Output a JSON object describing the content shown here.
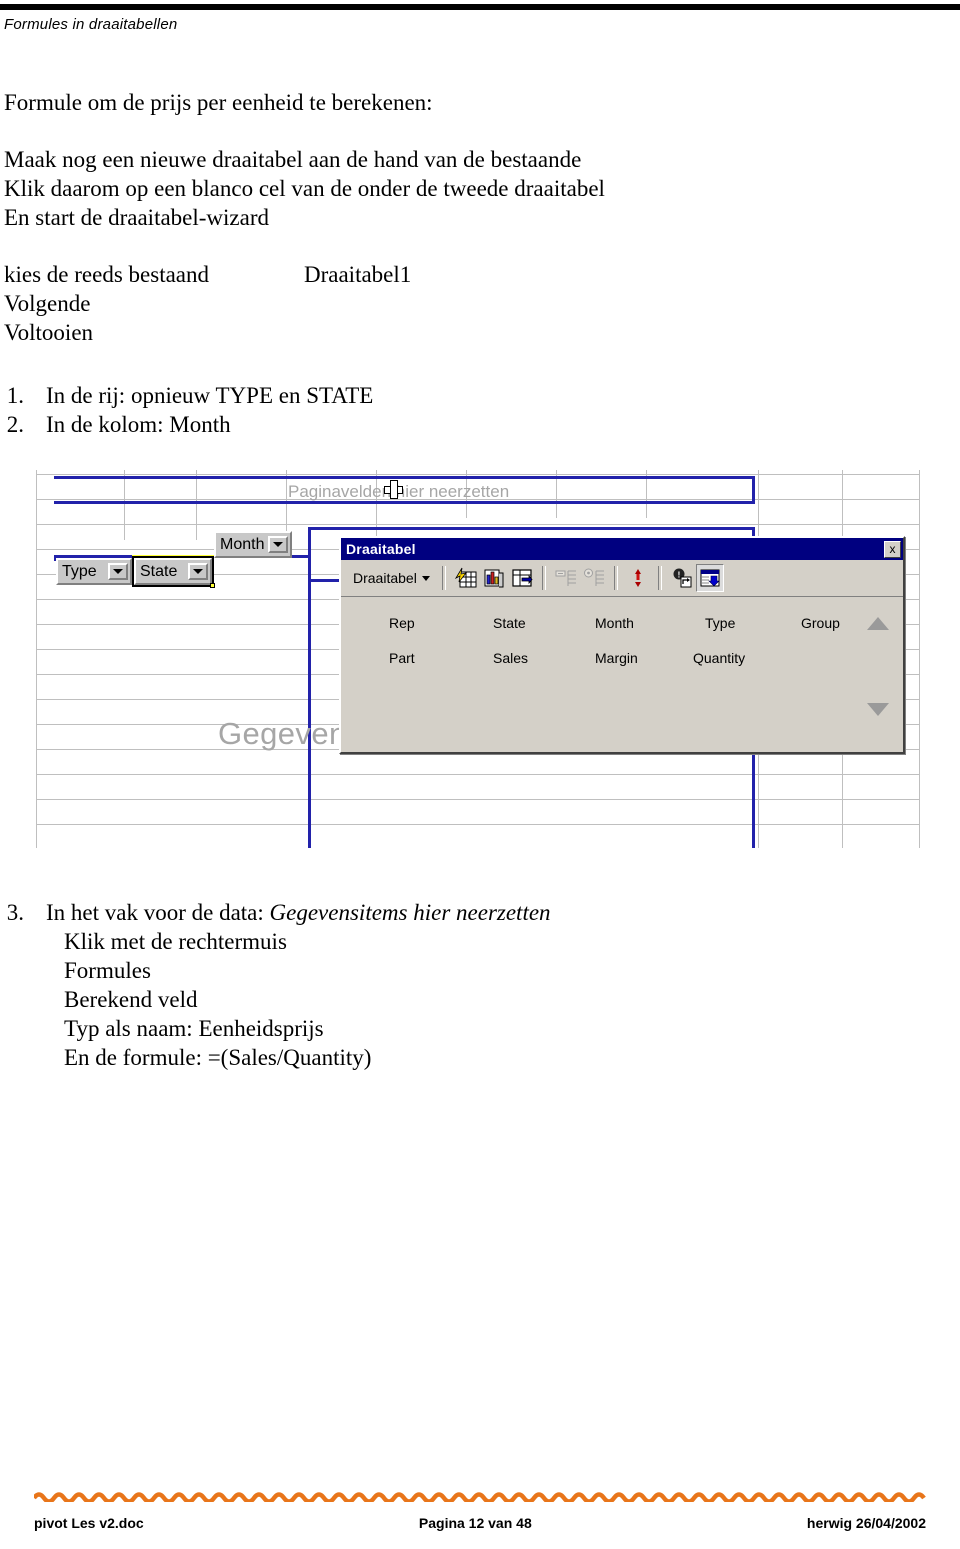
{
  "header": {
    "title": "Formules in draaitabellen"
  },
  "content": {
    "heading": "Formule om de prijs per eenheid te berekenen:",
    "lines": [
      "Maak nog een nieuwe draaitabel aan de hand van de bestaande",
      "Klik daarom op een blanco cel van de onder de tweede draaitabel",
      "En start de draaitabel-wizard"
    ],
    "choose_label": "kies de reeds bestaand",
    "choose_value": "Draaitabel1",
    "next_label": "Volgende",
    "finish_label": "Voltooien",
    "steps": [
      {
        "num": "1.",
        "text": "In de rij: opnieuw TYPE en STATE"
      },
      {
        "num": "2.",
        "text": "In de kolom: Month"
      }
    ],
    "step3": {
      "num": "3.",
      "prefix": "In het vak voor de data: ",
      "emphasis": "Gegevensitems hier neerzetten",
      "sublines": [
        "Klik met de rechtermuis",
        "Formules",
        "Berekend veld",
        "Typ als naam: Eenheidsprijs",
        "En de formule: =(Sales/Quantity)"
      ]
    }
  },
  "excel": {
    "page_drop_label": "Paginavelden hier neerzetten",
    "data_drop_label": "Gegevensitems hier neerzetten",
    "field_buttons": [
      {
        "label": "Type"
      },
      {
        "label": "State"
      },
      {
        "label": "Month"
      }
    ],
    "pivot_window": {
      "title": "Draaitabel",
      "close_label": "x",
      "menu_label": "Draaitabel",
      "toolbar_icons": [
        "pivot-wizard-icon",
        "pivot-chart-icon",
        "field-settings-icon",
        "show-detail-icon",
        "hide-detail-icon",
        "hide-detail-red-icon",
        "refresh-data-icon",
        "field-list-toggle-icon"
      ],
      "field_list": {
        "row1": [
          "Rep",
          "State",
          "Month",
          "Type",
          "Group"
        ],
        "row2": [
          "Part",
          "Sales",
          "Margin",
          "Quantity"
        ]
      }
    },
    "colors": {
      "pivot_outline": "#2222aa",
      "titlebar": "#000080",
      "window_face": "#d4d0c8",
      "grid_line": "#bfbfbf",
      "drop_label_text": "#a6a6a6",
      "selection_highlight": "#ffff33"
    }
  },
  "footer": {
    "left": "pivot Les v2.doc",
    "center": "Pagina 12 van 48",
    "right": "herwig 26/04/2002",
    "wave_color": "#e8751a"
  }
}
